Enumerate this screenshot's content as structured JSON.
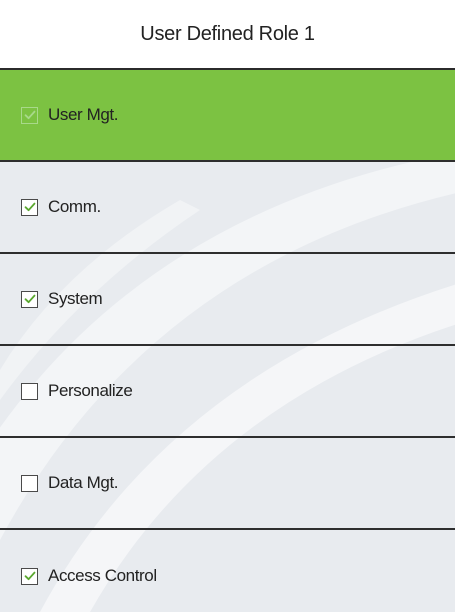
{
  "header": {
    "title": "User Defined Role 1"
  },
  "roles": [
    {
      "label": "User Mgt.",
      "checked": true,
      "selected": true
    },
    {
      "label": "Comm.",
      "checked": true,
      "selected": false
    },
    {
      "label": "System",
      "checked": true,
      "selected": false
    },
    {
      "label": "Personalize",
      "checked": false,
      "selected": false
    },
    {
      "label": "Data Mgt.",
      "checked": false,
      "selected": false
    },
    {
      "label": "Access Control",
      "checked": true,
      "selected": false
    }
  ],
  "colors": {
    "highlight": "#7cc242",
    "list_background": "#e8ebef",
    "check_mark": "#5aa82f",
    "divider": "#2e2e2e"
  },
  "icons": {
    "checkbox": "checkbox-icon",
    "check_mark": "check-mark-icon"
  }
}
